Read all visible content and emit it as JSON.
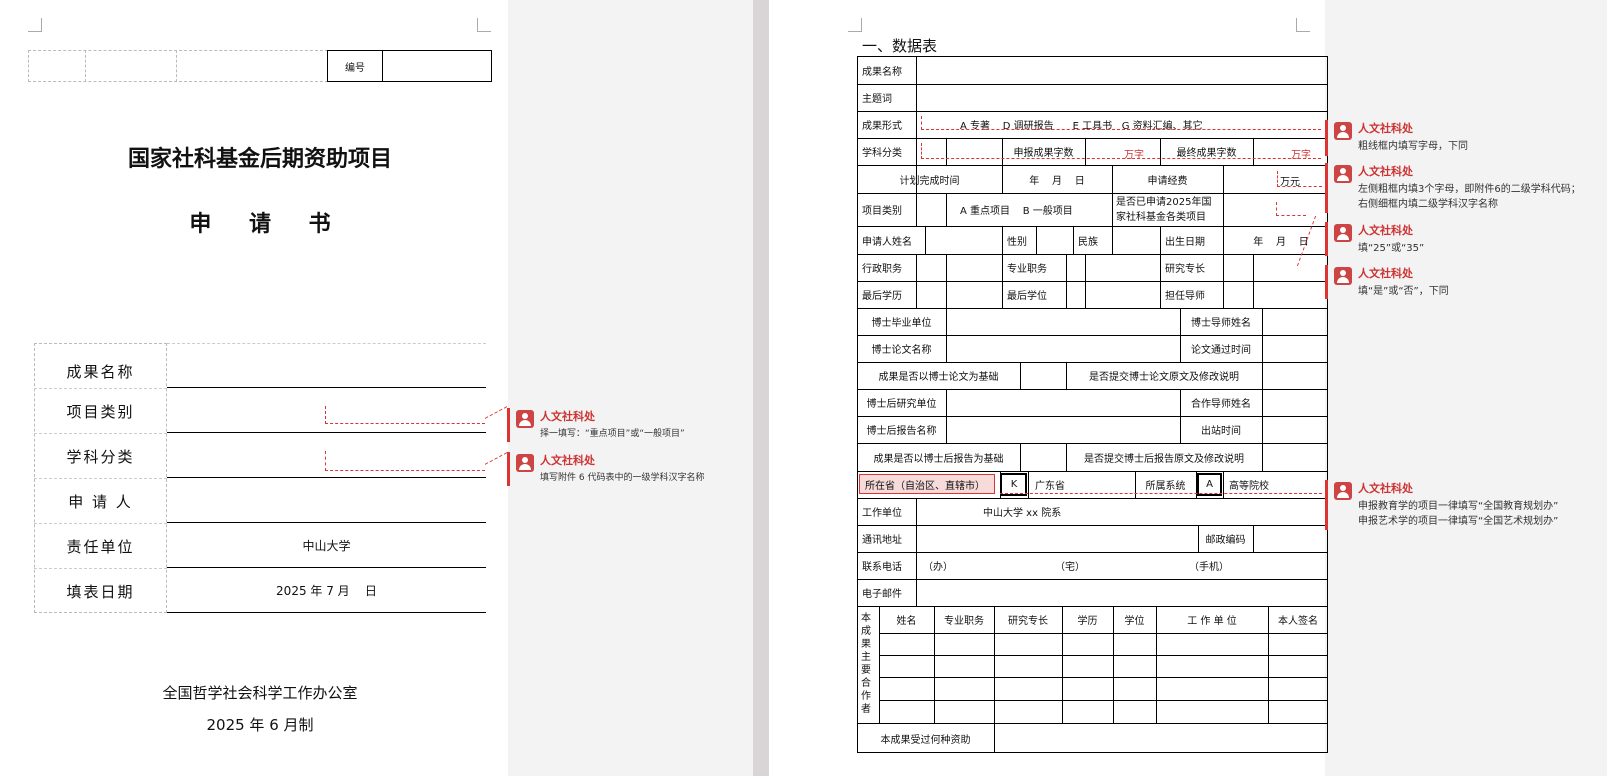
{
  "cover": {
    "biaohao_label": "编号",
    "title": "国家社科基金后期资助项目",
    "subtitle": "申 请 书",
    "rows": [
      {
        "label": "成果名称",
        "value": ""
      },
      {
        "label": "项目类别",
        "value": ""
      },
      {
        "label": "学科分类",
        "value": ""
      },
      {
        "label": "申 请 人",
        "value": ""
      },
      {
        "label": "责任单位",
        "value": "中山大学"
      },
      {
        "label": "填表日期",
        "value": "2025 年 7 月    日"
      }
    ],
    "footer_org": "全国哲学社会科学工作办公室",
    "footer_date": "2025 年 6 月制"
  },
  "comments_left": [
    {
      "author": "人文社科处",
      "text": "择一填写：“重点项目”或“一般项目”"
    },
    {
      "author": "人文社科处",
      "text": "填写附件 6 代码表中的一级学科汉字名称"
    }
  ],
  "sheet": {
    "heading": "一、数据表",
    "r_name": "成果名称",
    "r_keyword": "主题词",
    "r_form": "成果形式",
    "r_form_opts": "A 专著    D 调研报告      E 工具书   G 资料汇编、其它",
    "r_subject": "学科分类",
    "r_words_apply": "申报成果字数",
    "r_wan1": "万字",
    "r_words_final": "最终成果字数",
    "r_wan2": "万字",
    "r_plan": "计划完成时间",
    "r_ymd": "年    月    日",
    "r_fund": "申请经费",
    "r_wanyuan": "万元",
    "r_type": "项目类别",
    "r_type_opts": "A 重点项目    B 一般项目",
    "r_applied2025": "是否已申请2025年国家社科基金各类项目",
    "r_applicant": "申请人姓名",
    "r_gender": "性别",
    "r_ethnic": "民族",
    "r_birth": "出生日期",
    "r_ym": "年    月    日",
    "r_admin": "行政职务",
    "r_prof": "专业职务",
    "r_expert": "研究专长",
    "r_degree_edu": "最后学历",
    "r_degree": "最后学位",
    "r_advisor": "担任导师",
    "r_phd_unit": "博士毕业单位",
    "r_phd_tutor": "博士导师姓名",
    "r_phd_thesis": "博士论文名称",
    "r_thesis_time": "论文通过时间",
    "r_based_phd": "成果是否以博士论文为基础",
    "r_submit_phd": "是否提交博士论文原文及修改说明",
    "r_postdoc_unit": "博士后研究单位",
    "r_coop_tutor": "合作导师姓名",
    "r_postdoc_report": "博士后报告名称",
    "r_out_time": "出站时间",
    "r_based_postdoc": "成果是否以博士后报告为基础",
    "r_submit_postdoc": "是否提交博士后报告原文及修改说明",
    "r_province": "所在省（自治区、直辖市）",
    "r_prov_code": "K",
    "r_prov_name": "广东省",
    "r_system": "所属系统",
    "r_sys_code": "A",
    "r_sys_name": "高等院校",
    "r_workunit": "工作单位",
    "r_workunit_val": "中山大学 xx 院系",
    "r_address": "通讯地址",
    "r_zip": "邮政编码",
    "r_phone": "联系电话",
    "r_ph_office": "（办）",
    "r_ph_home": "（宅）",
    "r_ph_mobile": "（手机）",
    "r_email": "电子邮件",
    "members_vlabel": "本成果主要合作者",
    "members_headers": [
      "姓名",
      "专业职务",
      "研究专长",
      "学历",
      "学位",
      "工 作 单 位",
      "本人签名"
    ],
    "r_funded": "本成果受过何种资助"
  },
  "comments_right": [
    {
      "author": "人文社科处",
      "lines": [
        "粗线框内填写字母，下同"
      ]
    },
    {
      "author": "人文社科处",
      "lines": [
        "左侧粗框内填3个字母，即附件6的二级学科代码；",
        "右侧细框内填二级学科汉字名称"
      ]
    },
    {
      "author": "人文社科处",
      "lines": [
        "填“25”或“35”"
      ]
    },
    {
      "author": "人文社科处",
      "lines": [
        "填“是”或“否”，下同"
      ]
    },
    {
      "author": "人文社科处",
      "lines": [
        "申报教育学的项目一律填写“全国教育规划办”",
        "申报艺术学的项目一律填写“全国艺术规划办”"
      ]
    }
  ]
}
